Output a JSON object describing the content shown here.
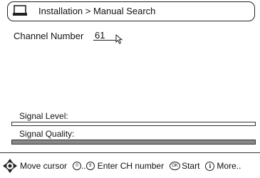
{
  "header": {
    "icon": "tv-icon",
    "title": "Installation > Manual Search"
  },
  "channel": {
    "label": "Channel Number",
    "value": "61"
  },
  "signal": {
    "level_label": "Signal Level:",
    "level_value": 0,
    "quality_label": "Signal Quality:",
    "quality_value": 1.0,
    "bar_fill_color": "#888888"
  },
  "footer": {
    "move_icon": "navigation-pad-icon",
    "move_label": "Move cursor",
    "digits_from": "0",
    "digits_sep": "..",
    "digits_to": "9",
    "enter_label": "Enter CH number",
    "ok_glyph": "OK",
    "start_label": "Start",
    "info_glyph": "i",
    "more_label": "More.."
  }
}
